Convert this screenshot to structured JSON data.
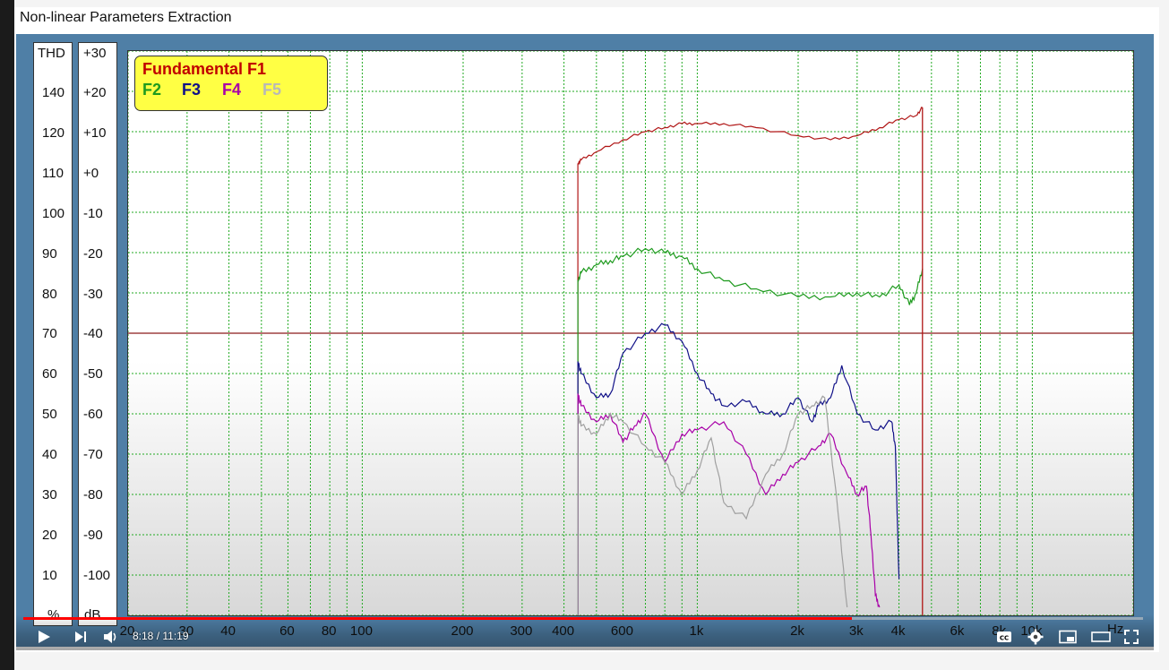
{
  "window": {
    "title": "Non-linear Parameters Extraction"
  },
  "scales": {
    "thd": {
      "header": "THD",
      "unit": "%",
      "labels": [
        "140",
        "120",
        "110",
        "100",
        "90",
        "80",
        "70",
        "60",
        "50",
        "40",
        "30",
        "20",
        "10"
      ]
    },
    "db": {
      "header": "+30",
      "unit": "dB",
      "labels": [
        "+20",
        "+10",
        "+0",
        "-10",
        "-20",
        "-30",
        "-40",
        "-50",
        "-60",
        "-70",
        "-80",
        "-90",
        "-100"
      ]
    }
  },
  "legend": {
    "f1": "Fundamental F1",
    "f2": "F2",
    "f3": "F3",
    "f4": "F4",
    "f5": "F5"
  },
  "x_axis": {
    "labels": [
      "20",
      "30",
      "40",
      "60",
      "80",
      "100",
      "200",
      "300",
      "400",
      "600",
      "1k",
      "2k",
      "3k",
      "4k",
      "6k",
      "8k",
      "10k"
    ],
    "unit": "Hz"
  },
  "colors": {
    "f1": "#b01515",
    "f2": "#1e9a1e",
    "f3": "#111188",
    "f4": "#a800a8",
    "f5": "#a0a0a0",
    "grid": "#22aa22",
    "threshold": "#8b1a1a"
  },
  "chart_data": {
    "type": "line",
    "xscale": "log",
    "xlim": [
      20,
      20000
    ],
    "ylim": [
      -110,
      30
    ],
    "xlabel": "Hz",
    "ylabel": "dB",
    "threshold_db": -40,
    "series": [
      {
        "name": "Fundamental F1",
        "x": [
          440,
          450,
          500,
          600,
          700,
          800,
          900,
          1000,
          1200,
          1500,
          2000,
          2500,
          3000,
          3500,
          4000,
          4500,
          4700
        ],
        "y": [
          2,
          3,
          5,
          8,
          10,
          11,
          12,
          12,
          12,
          11,
          9,
          8,
          9,
          11,
          13,
          14,
          16
        ]
      },
      {
        "name": "F2",
        "x": [
          440,
          450,
          500,
          550,
          600,
          700,
          800,
          900,
          1000,
          1200,
          1500,
          2000,
          2500,
          3000,
          3500,
          4000,
          4300,
          4500,
          4700
        ],
        "y": [
          -27,
          -25,
          -23,
          -22,
          -21,
          -19,
          -20,
          -21,
          -24,
          -27,
          -29,
          -31,
          -31,
          -30,
          -31,
          -28,
          -33,
          -30,
          -24
        ]
      },
      {
        "name": "F3",
        "x": [
          440,
          450,
          500,
          550,
          600,
          700,
          800,
          900,
          1000,
          1100,
          1200,
          1400,
          1600,
          1800,
          2000,
          2200,
          2300,
          2500,
          2700,
          3000,
          3400,
          3800,
          3900,
          4000
        ],
        "y": [
          -47,
          -50,
          -56,
          -55,
          -45,
          -40,
          -38,
          -42,
          -50,
          -55,
          -58,
          -57,
          -60,
          -60,
          -56,
          -62,
          -58,
          -56,
          -48,
          -60,
          -64,
          -62,
          -68,
          -101
        ]
      },
      {
        "name": "F4",
        "x": [
          440,
          450,
          500,
          550,
          600,
          650,
          700,
          800,
          900,
          1000,
          1200,
          1400,
          1600,
          1800,
          2000,
          2300,
          2500,
          2800,
          3000,
          3200,
          3300,
          3400,
          3500
        ],
        "y": [
          -55,
          -58,
          -62,
          -60,
          -67,
          -63,
          -60,
          -72,
          -65,
          -64,
          -62,
          -70,
          -80,
          -75,
          -72,
          -68,
          -65,
          -75,
          -80,
          -78,
          -90,
          -105,
          -108
        ]
      },
      {
        "name": "F5",
        "x": [
          440,
          450,
          500,
          550,
          600,
          700,
          800,
          900,
          1000,
          1100,
          1200,
          1400,
          1600,
          1800,
          2000,
          2200,
          2400,
          2600,
          2800
        ],
        "y": [
          -60,
          -63,
          -65,
          -60,
          -62,
          -68,
          -72,
          -80,
          -74,
          -66,
          -82,
          -86,
          -75,
          -70,
          -60,
          -58,
          -56,
          -80,
          -108
        ]
      }
    ]
  },
  "player": {
    "time": "8:18 / 11:19",
    "progress": 0.74
  }
}
